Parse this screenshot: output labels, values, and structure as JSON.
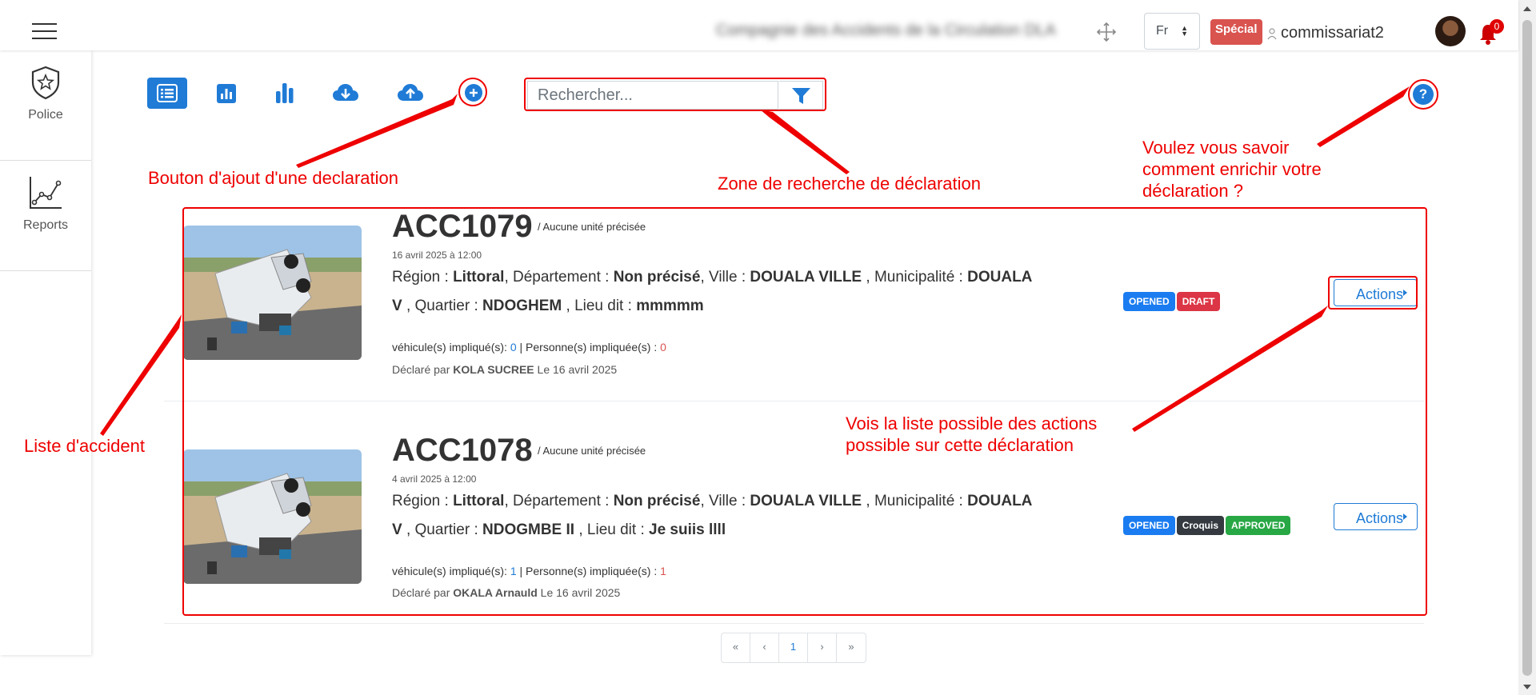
{
  "header": {
    "company": "Compagnie des Accidents de la Circulation DLA",
    "language": "Fr",
    "badge": "Spécial",
    "username": "commissariat2",
    "notification_count": "0"
  },
  "sidebar": {
    "items": [
      {
        "label": "Police",
        "icon": "police-shield-icon"
      },
      {
        "label": "Reports",
        "icon": "line-chart-icon"
      }
    ]
  },
  "toolbar": {
    "icons": [
      "list-view-icon",
      "report-chart-icon",
      "bar-chart-icon",
      "cloud-download-icon",
      "cloud-upload-icon",
      "add-circle-icon"
    ],
    "search_placeholder": "Rechercher...",
    "help_label": "?"
  },
  "annotations": {
    "add_button": "Bouton d'ajout d'une declaration",
    "search_zone": "Zone de recherche de déclaration",
    "help_line1": "Voulez vous savoir",
    "help_line2": "comment enrichir votre",
    "help_line3": "déclaration ?",
    "list": "Liste d'accident",
    "actions_line1": "Vois la liste possible des actions",
    "actions_line2": "possible sur cette déclaration"
  },
  "labels": {
    "region": "Région :",
    "departement": ", Département :",
    "ville": ", Ville :",
    "municipalite": ", Municipalité :",
    "quartier": ", Quartier :",
    "lieu": ", Lieu dit :",
    "vehicules": "véhicule(s) impliqué(s):",
    "personnes": "| Personne(s) impliquée(s) :",
    "declare_par": "Déclaré par",
    "actions": "Actions"
  },
  "accidents": [
    {
      "code": "ACC1079",
      "unit": "/ Aucune unité précisée",
      "datetime": "16 avril 2025 à 12:00",
      "region": "Littoral",
      "departement": "Non précisé",
      "ville": "DOUALA VILLE",
      "municipalite_a": "DOUALA",
      "municipalite_b": "V",
      "quartier": "NDOGHEM",
      "lieu_dit": "mmmmm",
      "vehicules": "0",
      "personnes": "0",
      "declarant": "KOLA SUCREE",
      "declared_on": "Le 16 avril 2025",
      "badges": [
        {
          "text": "OPENED",
          "color": "#1a7cf0"
        },
        {
          "text": "DRAFT",
          "color": "#dc3545"
        }
      ]
    },
    {
      "code": "ACC1078",
      "unit": "/ Aucune unité précisée",
      "datetime": "4 avril 2025 à 12:00",
      "region": "Littoral",
      "departement": "Non précisé",
      "ville": "DOUALA VILLE",
      "municipalite_a": "DOUALA",
      "municipalite_b": "V",
      "quartier": "NDOGMBE II",
      "lieu_dit": "Je suiis llll",
      "vehicules": "1",
      "personnes": "1",
      "declarant": "OKALA Arnauld",
      "declared_on": "Le 16 avril 2025",
      "badges": [
        {
          "text": "OPENED",
          "color": "#1a7cf0"
        },
        {
          "text": "Croquis",
          "color": "#343a40"
        },
        {
          "text": "APPROVED",
          "color": "#28a745"
        }
      ]
    }
  ],
  "pagination": {
    "first": "«",
    "prev": "‹",
    "current": "1",
    "next": "›",
    "last": "»"
  },
  "colors": {
    "primary": "#1f7bd6",
    "annotation": "#ee0000",
    "special_badge": "#d9534f"
  }
}
